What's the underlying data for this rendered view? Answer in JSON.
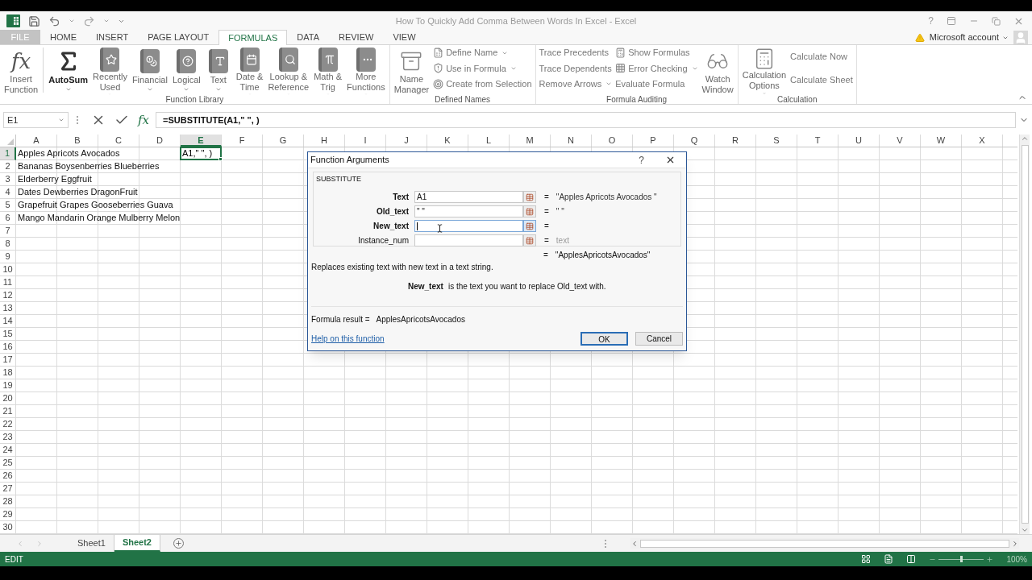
{
  "window": {
    "title": "How To Quickly Add Comma Between Words In Excel - Excel",
    "help": "?",
    "account": "Microsoft account"
  },
  "tabs": [
    {
      "label": "FILE",
      "selected": false
    },
    {
      "label": "HOME",
      "selected": false
    },
    {
      "label": "INSERT",
      "selected": false
    },
    {
      "label": "PAGE LAYOUT",
      "selected": false
    },
    {
      "label": "FORMULAS",
      "selected": true
    },
    {
      "label": "DATA",
      "selected": false
    },
    {
      "label": "REVIEW",
      "selected": false
    },
    {
      "label": "VIEW",
      "selected": false
    }
  ],
  "ribbon": {
    "groups": [
      {
        "label": "Function Library",
        "columns": [
          {
            "kind": "large",
            "icon_text": "fx",
            "lines": [
              "Insert",
              "Function"
            ],
            "dropdown": false,
            "bold": false
          },
          {
            "kind": "large",
            "lines": [
              "AutoSum"
            ],
            "dropdown": true,
            "bold": true
          },
          {
            "kind": "large",
            "lines": [
              "Recently",
              "Used"
            ],
            "dropdown": true,
            "bold": false
          },
          {
            "kind": "large",
            "lines": [
              "Financial"
            ],
            "dropdown": true,
            "bold": false
          },
          {
            "kind": "large",
            "lines": [
              "Logical"
            ],
            "dropdown": true,
            "bold": false
          },
          {
            "kind": "large",
            "lines": [
              "Text"
            ],
            "dropdown": true,
            "bold": false
          },
          {
            "kind": "large",
            "lines": [
              "Date &",
              "Time"
            ],
            "dropdown": true,
            "bold": false
          },
          {
            "kind": "large",
            "lines": [
              "Lookup &",
              "Reference"
            ],
            "dropdown": true,
            "bold": false
          },
          {
            "kind": "large",
            "lines": [
              "Math &",
              "Trig"
            ],
            "dropdown": true,
            "bold": false
          },
          {
            "kind": "large",
            "lines": [
              "More",
              "Functions"
            ],
            "dropdown": true,
            "bold": false
          }
        ]
      },
      {
        "label": "Defined Names",
        "columns": [
          {
            "kind": "large",
            "lines": [
              "Name",
              "Manager"
            ],
            "dropdown": false,
            "bold": false
          },
          {
            "kind": "small",
            "items": [
              {
                "label": "Define Name",
                "dropdown": true
              },
              {
                "label": "Use in Formula",
                "dropdown": true
              },
              {
                "label": "Create from Selection",
                "dropdown": false
              }
            ]
          }
        ]
      },
      {
        "label": "Formula Auditing",
        "columns": [
          {
            "kind": "small",
            "items": [
              {
                "label": "Trace Precedents",
                "dropdown": false
              },
              {
                "label": "Trace Dependents",
                "dropdown": false
              },
              {
                "label": "Remove Arrows",
                "dropdown": true
              }
            ]
          },
          {
            "kind": "small",
            "items": [
              {
                "label": "Show Formulas",
                "dropdown": false
              },
              {
                "label": "Error Checking",
                "dropdown": true
              },
              {
                "label": "Evaluate Formula",
                "dropdown": false
              }
            ]
          },
          {
            "kind": "large",
            "lines": [
              "Watch",
              "Window"
            ],
            "dropdown": false,
            "bold": false
          }
        ]
      },
      {
        "label": "Calculation",
        "columns": [
          {
            "kind": "large",
            "lines": [
              "Calculation",
              "Options"
            ],
            "dropdown": true,
            "bold": false
          },
          {
            "kind": "small",
            "items": [
              {
                "label": "Calculate Now",
                "dropdown": false
              },
              {
                "label": "Calculate Sheet",
                "dropdown": false
              }
            ]
          }
        ]
      }
    ]
  },
  "formula_bar": {
    "name_box": "E1",
    "fx": "fx",
    "formula": "=SUBSTITUTE(A1,\" \", )"
  },
  "columns": [
    {
      "label": "A",
      "selected": false
    },
    {
      "label": "B",
      "selected": false
    },
    {
      "label": "C",
      "selected": false
    },
    {
      "label": "D",
      "selected": false
    },
    {
      "label": "E",
      "selected": true
    },
    {
      "label": "F",
      "selected": false
    },
    {
      "label": "G",
      "selected": false
    },
    {
      "label": "H",
      "selected": false
    },
    {
      "label": "I",
      "selected": false
    },
    {
      "label": "J",
      "selected": false
    },
    {
      "label": "K",
      "selected": false
    },
    {
      "label": "L",
      "selected": false
    },
    {
      "label": "M",
      "selected": false
    },
    {
      "label": "N",
      "selected": false
    },
    {
      "label": "O",
      "selected": false
    },
    {
      "label": "P",
      "selected": false
    },
    {
      "label": "Q",
      "selected": false
    },
    {
      "label": "R",
      "selected": false
    },
    {
      "label": "S",
      "selected": false
    },
    {
      "label": "T",
      "selected": false
    },
    {
      "label": "U",
      "selected": false
    },
    {
      "label": "V",
      "selected": false
    },
    {
      "label": "W",
      "selected": false
    },
    {
      "label": "X",
      "selected": false
    }
  ],
  "rows": [
    {
      "number": "1",
      "selected": true,
      "a": "Apples Apricots Avocados",
      "e": {
        "text": "A1,\" \", )",
        "active": true
      }
    },
    {
      "number": "2",
      "selected": false,
      "a": "Bananas Boysenberries Blueberries"
    },
    {
      "number": "3",
      "selected": false,
      "a": "Elderberry Eggfruit"
    },
    {
      "number": "4",
      "selected": false,
      "a": "Dates Dewberries DragonFruit"
    },
    {
      "number": "5",
      "selected": false,
      "a": "Grapefruit Grapes Gooseberries Guava"
    },
    {
      "number": "6",
      "selected": false,
      "a": "Mango Mandarin Orange Mulberry Melon"
    },
    {
      "number": "7",
      "selected": false
    },
    {
      "number": "8",
      "selected": false
    },
    {
      "number": "9",
      "selected": false
    },
    {
      "number": "10",
      "selected": false
    },
    {
      "number": "11",
      "selected": false
    },
    {
      "number": "12",
      "selected": false
    },
    {
      "number": "13",
      "selected": false
    },
    {
      "number": "14",
      "selected": false
    },
    {
      "number": "15",
      "selected": false
    },
    {
      "number": "16",
      "selected": false
    },
    {
      "number": "17",
      "selected": false
    },
    {
      "number": "18",
      "selected": false
    },
    {
      "number": "19",
      "selected": false
    },
    {
      "number": "20",
      "selected": false
    },
    {
      "number": "21",
      "selected": false
    },
    {
      "number": "22",
      "selected": false
    },
    {
      "number": "23",
      "selected": false
    },
    {
      "number": "24",
      "selected": false
    },
    {
      "number": "25",
      "selected": false
    },
    {
      "number": "26",
      "selected": false
    },
    {
      "number": "27",
      "selected": false
    },
    {
      "number": "28",
      "selected": false
    },
    {
      "number": "29",
      "selected": false
    },
    {
      "number": "30",
      "selected": false
    }
  ],
  "dialog": {
    "title": "Function Arguments",
    "help": "?",
    "function": "SUBSTITUTE",
    "args": [
      {
        "label": "Text",
        "value": "A1",
        "eq": "=",
        "result": "\"Apples Apricots Avocados \"",
        "hint": false,
        "focused": false,
        "bold": true
      },
      {
        "label": "Old_text",
        "value": "\" \"",
        "eq": "=",
        "result": "\" \"",
        "hint": false,
        "focused": false,
        "bold": true
      },
      {
        "label": "New_text",
        "eq": "=",
        "focused": true,
        "bold": true
      },
      {
        "label": "Instance_num",
        "eq": "=",
        "result": "text",
        "hint": true,
        "focused": false,
        "bold": false
      }
    ],
    "preview_eq": "=",
    "preview": "\"ApplesApricotsAvocados\"",
    "description": "Replaces existing text with new text in a text string.",
    "arg_name": "New_text",
    "arg_description": "is the text you want to replace Old_text with.",
    "result_label": "Formula result =",
    "result": "ApplesApricotsAvocados",
    "help_link": "Help on this function",
    "buttons": [
      "OK",
      "Cancel"
    ]
  },
  "sheet_tabs": [
    {
      "label": "Sheet1",
      "selected": false
    },
    {
      "label": "Sheet2",
      "selected": true
    }
  ],
  "status_bar": {
    "mode": "EDIT",
    "zoom": {
      "level": 0.5,
      "label": "100%"
    }
  }
}
